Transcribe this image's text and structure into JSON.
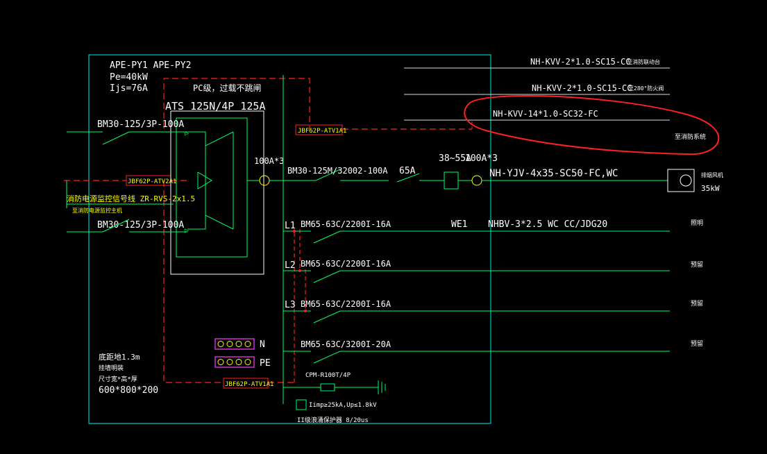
{
  "panel": {
    "name": "APE-PY1  APE-PY2",
    "pe": "Pe=40kW",
    "ijs": "Ijs=76A",
    "pc_label": "PC级，过载不跳闸",
    "ats": "ATS 125N/4P 125A",
    "install_height": "底距地1.3m",
    "mount": "挂墙明装",
    "size_label": "尺寸宽*高*厚",
    "size": "600*800*200"
  },
  "incoming": {
    "breaker1": "BM30-125/3P-100A",
    "breaker2": "BM30-125/3P-100A",
    "fire_signal": "消防电源监控信号线 ZR-RVS-2x1.5",
    "fire_signal_2": "至消防电源监控主机",
    "module_atv2a1": "JBF62P-ATV2A1"
  },
  "control_lines": {
    "line1": "NH-KVV-2*1.0-SC15-CC",
    "line1_note": "至消防联动台",
    "line2": "NH-KVV-2*1.0-SC15-CC",
    "line2_note": "至280°防火阀",
    "line3": "NH-KVV-14*1.0-SC32-FC",
    "line3_note": "至消防系统",
    "module_top": "JBF62P-ATV1A1"
  },
  "main_circuit": {
    "ct1": "100A*3",
    "breaker": "BM30-125M/32002-100A",
    "rating": "65A",
    "thermal": "38~55A",
    "ct2": "100A*3",
    "cable": "NH-YJV-4x35-SC50-FC,WC",
    "load_name": "排烟风机",
    "load_power": "35kW"
  },
  "branches": [
    {
      "phase": "L1",
      "breaker": "BM65-63C/2200I-16A",
      "circuit": "WE1",
      "cable": "NHBV-3*2.5  WC CC/JDG20",
      "use": "照明"
    },
    {
      "phase": "L2",
      "breaker": "BM65-63C/2200I-16A",
      "circuit": "",
      "cable": "",
      "use": "预留"
    },
    {
      "phase": "L3",
      "breaker": "BM65-63C/2200I-16A",
      "circuit": "",
      "cable": "",
      "use": "预留"
    },
    {
      "phase": "",
      "breaker": "BM65-63C/3200I-20A",
      "circuit": "",
      "cable": "",
      "use": "预留"
    }
  ],
  "bus": {
    "n": "N",
    "pe": "PE"
  },
  "spd": {
    "model": "CPM-R100T/4P",
    "rating": "Iimp≥25kA,Up≤1.8kV",
    "class": "II级浪涌保护器 8/20us",
    "module_bottom": "JBF62P-ATV1A1"
  },
  "colors": {
    "frame": "#00c8c8",
    "wire": "#00ff66",
    "dash": "#ff2020",
    "highlight": "#ff2020",
    "text": "#ffffff",
    "label": "#ffff00",
    "terminal": "#cc33cc"
  }
}
